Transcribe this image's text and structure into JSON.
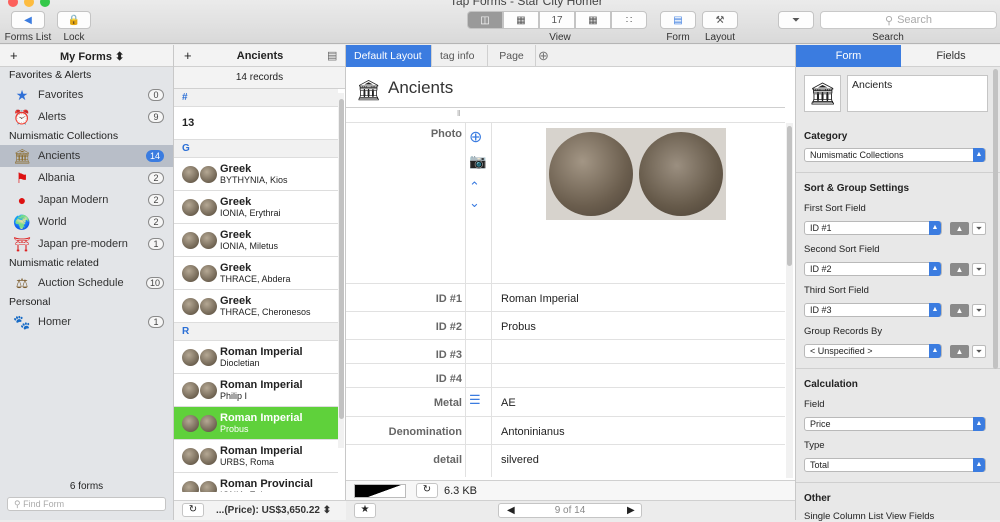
{
  "window": {
    "title": "Tap Forms ‑ Star City Homer"
  },
  "toolbar": {
    "forms_list": "Forms List",
    "lock": "Lock",
    "view": "View",
    "form": "Form",
    "layout": "Layout",
    "search_placeholder": "Search",
    "search_label": "Search"
  },
  "sidebar": {
    "header": "My Forms ⬍",
    "sections": [
      {
        "title": "Favorites & Alerts",
        "items": [
          {
            "label": "Favorites",
            "count": "0",
            "icon": "star-icon"
          },
          {
            "label": "Alerts",
            "count": "9",
            "icon": "alarm-clock-icon"
          }
        ]
      },
      {
        "title": "Numismatic Collections",
        "items": [
          {
            "label": "Ancients",
            "count": "14",
            "icon": "temple-icon",
            "selected": true
          },
          {
            "label": "Albania",
            "count": "2",
            "icon": "albania-flag-icon"
          },
          {
            "label": "Japan Modern",
            "count": "2",
            "icon": "japan-flag-icon"
          },
          {
            "label": "World",
            "count": "2",
            "icon": "globe-icon"
          },
          {
            "label": "Japan pre-modern",
            "count": "1",
            "icon": "torii-icon"
          }
        ]
      },
      {
        "title": "Numismatic related",
        "items": [
          {
            "label": "Auction Schedule",
            "count": "10",
            "icon": "gavel-icon"
          }
        ]
      },
      {
        "title": "Personal",
        "items": [
          {
            "label": "Homer",
            "count": "1",
            "icon": "paw-icon"
          }
        ]
      }
    ],
    "footer_count": "6 forms",
    "find_placeholder": "Find Form"
  },
  "list": {
    "title": "Ancients",
    "count": "14 records",
    "groups": [
      {
        "letter": "#",
        "rows": [
          {
            "title": "13",
            "subtitle": "",
            "thumb": false
          }
        ]
      },
      {
        "letter": "G",
        "rows": [
          {
            "title": "Greek",
            "subtitle": "BYTHYNIA, Kios",
            "thumb": true
          },
          {
            "title": "Greek",
            "subtitle": "IONIA, Erythrai",
            "thumb": true
          },
          {
            "title": "Greek",
            "subtitle": "IONIA, Miletus",
            "thumb": true
          },
          {
            "title": "Greek",
            "subtitle": "THRACE, Abdera",
            "thumb": true
          },
          {
            "title": "Greek",
            "subtitle": "THRACE, Cheronesos",
            "thumb": true
          }
        ]
      },
      {
        "letter": "R",
        "rows": [
          {
            "title": "Roman Imperial",
            "subtitle": "Diocletian",
            "thumb": true
          },
          {
            "title": "Roman Imperial",
            "subtitle": "Philip I",
            "thumb": true
          },
          {
            "title": "Roman Imperial",
            "subtitle": "Probus",
            "thumb": true,
            "selected": true
          },
          {
            "title": "Roman Imperial",
            "subtitle": "URBS, Roma",
            "thumb": true
          },
          {
            "title": "Roman Provincial",
            "subtitle": "IONIA, Ephesus",
            "thumb": true
          }
        ]
      }
    ],
    "footer_total": "...(Price): US$3,650.22 ⬍"
  },
  "main": {
    "tabs": [
      "Default Layout",
      "tag info",
      "Page"
    ],
    "record_title": "Ancients",
    "fields": [
      {
        "label": "Photo",
        "value": ""
      },
      {
        "label": "ID #1",
        "value": "Roman Imperial"
      },
      {
        "label": "ID #2",
        "value": "Probus"
      },
      {
        "label": "ID #3",
        "value": ""
      },
      {
        "label": "ID #4",
        "value": ""
      },
      {
        "label": "Metal",
        "value": "AE"
      },
      {
        "label": "Denomination",
        "value": "Antoninianus"
      },
      {
        "label": "detail",
        "value": "silvered"
      }
    ],
    "size": "6.3 KB",
    "pager": "9 of 14"
  },
  "inspector": {
    "tabs": [
      "Form",
      "Fields"
    ],
    "form_name": "Ancients",
    "category_label": "Category",
    "category_value": "Numismatic Collections",
    "sort_header": "Sort & Group Settings",
    "first_sort_label": "First Sort Field",
    "first_sort_value": "ID #1",
    "second_sort_label": "Second Sort Field",
    "second_sort_value": "ID #2",
    "third_sort_label": "Third Sort Field",
    "third_sort_value": "ID #3",
    "group_label": "Group Records By",
    "group_value": "< Unspecified >",
    "calc_header": "Calculation",
    "field_label": "Field",
    "field_value": "Price",
    "type_label": "Type",
    "type_value": "Total",
    "other_header": "Other",
    "single_col_label": "Single Column List View Fields"
  },
  "colors": {
    "accent": "#3b7ce0",
    "selected_row": "#5fd13b"
  }
}
